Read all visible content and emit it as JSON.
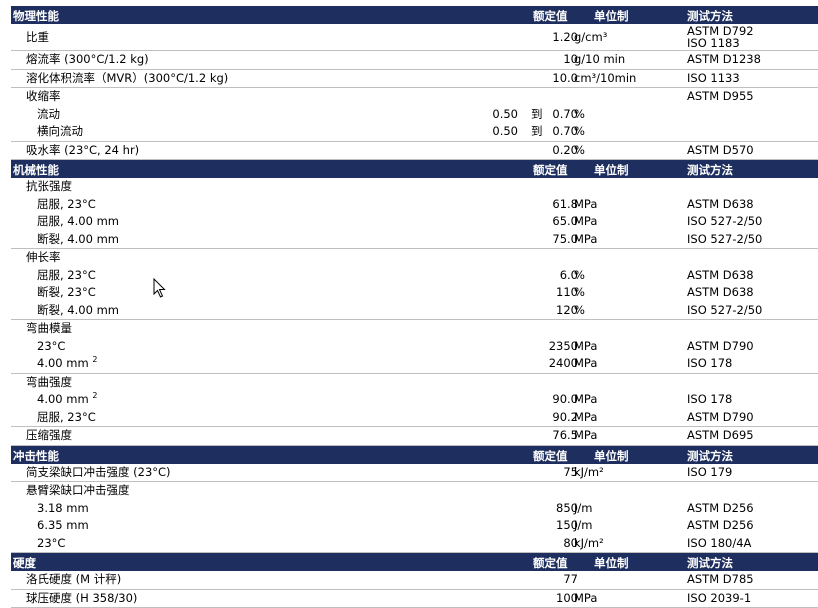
{
  "sections": [
    {
      "header": {
        "title": "物理性能",
        "value_col": "额定值",
        "unit_col": "单位制",
        "method_col": "测试方法"
      },
      "groups": [
        {
          "rows": [
            {
              "level": 1,
              "label": "比重",
              "value": "1.20",
              "unit": "g/cm³",
              "method": [
                "ASTM D792",
                "ISO 1183"
              ],
              "tall": true
            }
          ]
        },
        {
          "rows": [
            {
              "level": 1,
              "label": "熔流率 (300°C/1.2 kg)",
              "value": "10",
              "unit": "g/10 min",
              "method": [
                "ASTM D1238"
              ]
            }
          ]
        },
        {
          "rows": [
            {
              "level": 1,
              "label": "溶化体积流率（MVR）(300°C/1.2 kg)",
              "value": "10.0",
              "unit": "cm³/10min",
              "method": [
                "ISO 1133"
              ]
            }
          ]
        },
        {
          "rows": [
            {
              "level": 1,
              "label": "收缩率",
              "value": "",
              "unit": "",
              "method": [
                "ASTM D955"
              ]
            },
            {
              "level": 2,
              "label": "流动",
              "value": "0.50",
              "to": "到",
              "value2": "0.70",
              "unit": "%",
              "method": []
            },
            {
              "level": 2,
              "label": "横向流动",
              "value": "0.50",
              "to": "到",
              "value2": "0.70",
              "unit": "%",
              "method": []
            }
          ]
        },
        {
          "rows": [
            {
              "level": 1,
              "label": "吸水率 (23°C, 24 hr)",
              "value": "0.20",
              "unit": "%",
              "method": [
                "ASTM D570"
              ]
            }
          ]
        }
      ]
    },
    {
      "header": {
        "title": "机械性能",
        "value_col": "额定值",
        "unit_col": "单位制",
        "method_col": "测试方法"
      },
      "groups": [
        {
          "rows": [
            {
              "level": 1,
              "label": "抗张强度",
              "value": "",
              "unit": "",
              "method": []
            },
            {
              "level": 2,
              "label": "屈服, 23°C",
              "value": "61.8",
              "unit": "MPa",
              "method": [
                "ASTM D638"
              ]
            },
            {
              "level": 2,
              "label": "屈服, 4.00 mm",
              "value": "65.0",
              "unit": "MPa",
              "method": [
                "ISO 527-2/50"
              ]
            },
            {
              "level": 2,
              "label": "断裂, 4.00 mm",
              "value": "75.0",
              "unit": "MPa",
              "method": [
                "ISO 527-2/50"
              ]
            }
          ]
        },
        {
          "rows": [
            {
              "level": 1,
              "label": "伸长率",
              "value": "",
              "unit": "",
              "method": []
            },
            {
              "level": 2,
              "label": "屈服, 23°C",
              "value": "6.0",
              "unit": "%",
              "method": [
                "ASTM D638"
              ]
            },
            {
              "level": 2,
              "label": "断裂, 23°C",
              "value": "110",
              "unit": "%",
              "method": [
                "ASTM D638"
              ]
            },
            {
              "level": 2,
              "label": "断裂, 4.00 mm",
              "value": "120",
              "unit": "%",
              "method": [
                "ISO 527-2/50"
              ]
            }
          ]
        },
        {
          "rows": [
            {
              "level": 1,
              "label": "弯曲模量",
              "value": "",
              "unit": "",
              "method": []
            },
            {
              "level": 2,
              "label": "23°C",
              "value": "2350",
              "unit": "MPa",
              "method": [
                "ASTM D790"
              ]
            },
            {
              "level": 2,
              "label": "4.00 mm",
              "sup": "2",
              "value": "2400",
              "unit": "MPa",
              "method": [
                "ISO 178"
              ]
            }
          ]
        },
        {
          "rows": [
            {
              "level": 1,
              "label": "弯曲强度",
              "value": "",
              "unit": "",
              "method": []
            },
            {
              "level": 2,
              "label": "4.00 mm",
              "sup": "2",
              "value": "90.0",
              "unit": "MPa",
              "method": [
                "ISO 178"
              ]
            },
            {
              "level": 2,
              "label": "屈服, 23°C",
              "value": "90.2",
              "unit": "MPa",
              "method": [
                "ASTM D790"
              ]
            }
          ]
        },
        {
          "rows": [
            {
              "level": 1,
              "label": "压缩强度",
              "value": "76.5",
              "unit": "MPa",
              "method": [
                "ASTM D695"
              ]
            }
          ]
        }
      ]
    },
    {
      "header": {
        "title": "冲击性能",
        "value_col": "额定值",
        "unit_col": "单位制",
        "method_col": "测试方法"
      },
      "groups": [
        {
          "rows": [
            {
              "level": 1,
              "label": "简支梁缺口冲击强度 (23°C)",
              "value": "75",
              "unit": "kJ/m²",
              "method": [
                "ISO 179"
              ]
            }
          ]
        },
        {
          "rows": [
            {
              "level": 1,
              "label": "悬臂梁缺口冲击强度",
              "value": "",
              "unit": "",
              "method": []
            },
            {
              "level": 2,
              "label": "3.18 mm",
              "value": "850",
              "unit": "J/m",
              "method": [
                "ASTM D256"
              ]
            },
            {
              "level": 2,
              "label": "6.35 mm",
              "value": "150",
              "unit": "J/m",
              "method": [
                "ASTM D256"
              ]
            },
            {
              "level": 2,
              "label": "23°C",
              "value": "80",
              "unit": "kJ/m²",
              "method": [
                "ISO 180/4A"
              ]
            }
          ]
        }
      ]
    },
    {
      "header": {
        "title": "硬度",
        "value_col": "额定值",
        "unit_col": "单位制",
        "method_col": "测试方法"
      },
      "groups": [
        {
          "rows": [
            {
              "level": 1,
              "label": "洛氏硬度 (M 计秤)",
              "value": "77",
              "unit": "",
              "method": [
                "ASTM D785"
              ]
            }
          ]
        },
        {
          "rows": [
            {
              "level": 1,
              "label": "球压硬度 (H 358/30)",
              "value": "100",
              "unit": "MPa",
              "method": [
                "ISO 2039-1"
              ]
            }
          ]
        }
      ]
    }
  ],
  "cursor_icon": "arrow-cursor-icon",
  "colors": {
    "header_bg": "#1e2f5f",
    "header_text": "#ffffff",
    "rule": "#bfbfbf"
  }
}
